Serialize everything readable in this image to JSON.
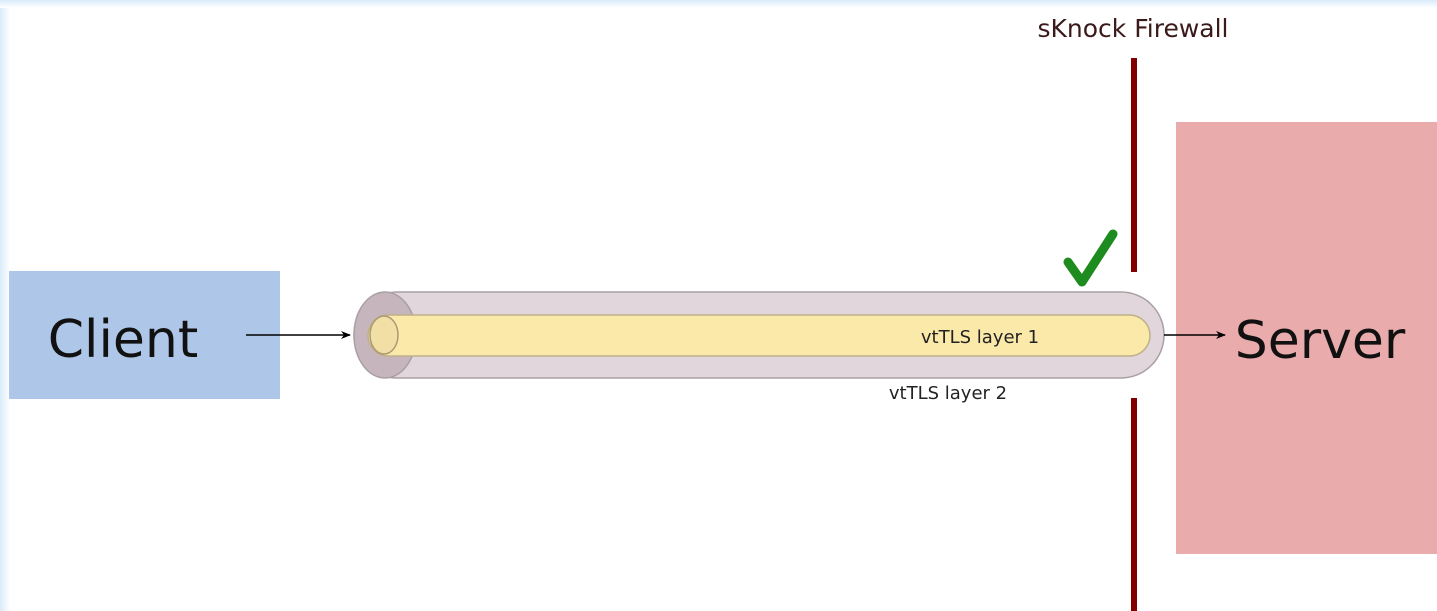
{
  "labels": {
    "client": "Client",
    "server": "Server",
    "firewall": "sKnock Firewall",
    "inner_layer": "vtTLS layer 1",
    "outer_layer": "vtTLS layer 2"
  },
  "icons": {
    "firewall_pass": "check-mark-icon"
  },
  "colors": {
    "client_box": "#aec6e8",
    "server_box": "#e9abab",
    "firewall_line": "#800000",
    "check_mark": "#1e8b1e",
    "outer_tunnel": "#e0d6db",
    "inner_tunnel": "#fbe9a9",
    "background_frame": "#e3f1fb"
  }
}
